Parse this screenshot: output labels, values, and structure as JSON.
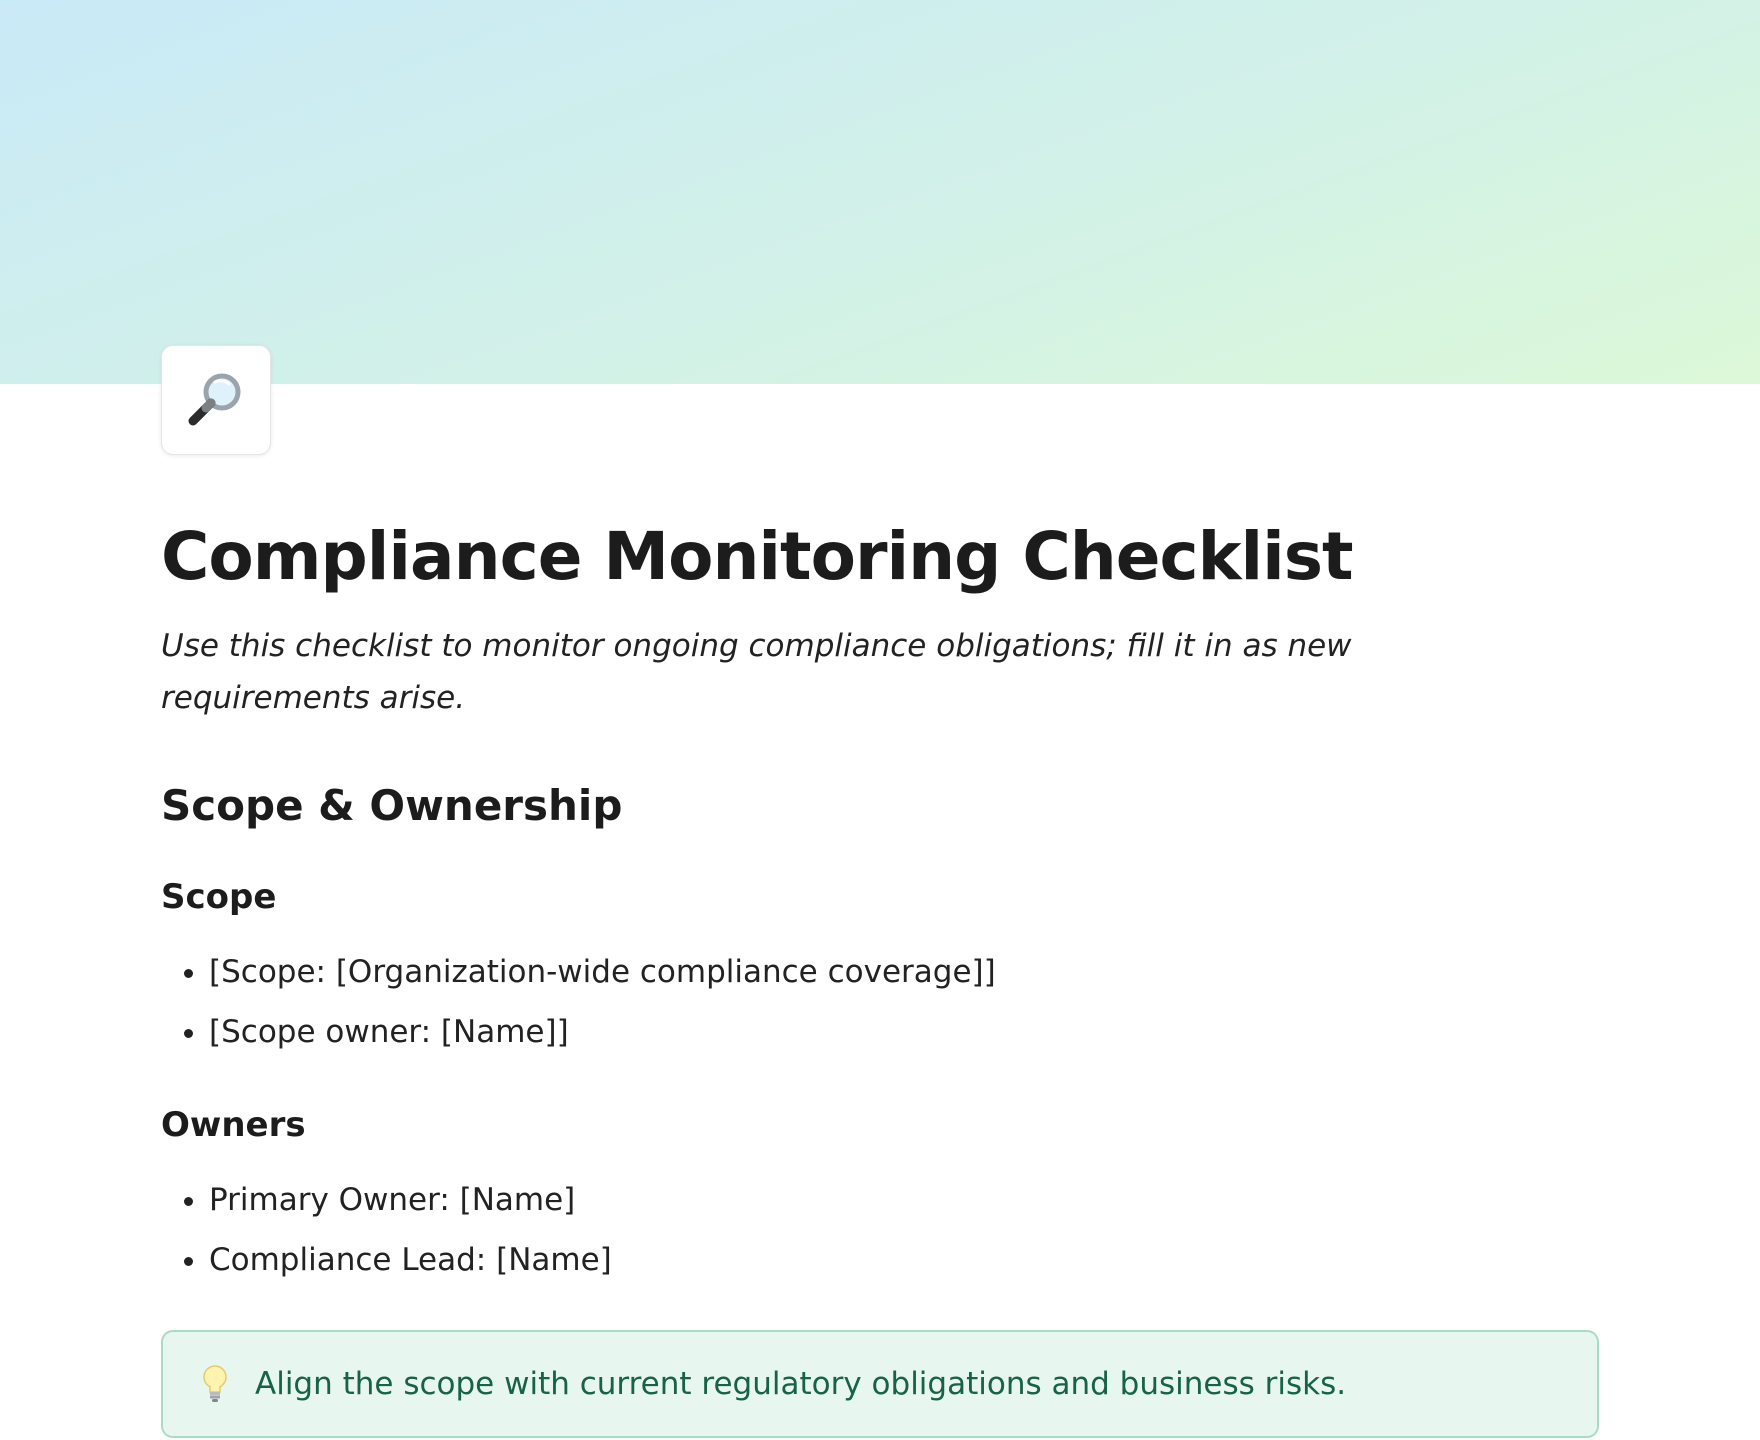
{
  "page": {
    "icon": "magnifying-glass-icon",
    "title": "Compliance Monitoring Checklist",
    "subtitle": "Use this checklist to monitor ongoing compliance obligations; fill it in as new requirements arise."
  },
  "sections": [
    {
      "heading": "Scope & Ownership",
      "subsections": [
        {
          "heading": "Scope",
          "items": [
            "[Scope: [Organization-wide compliance coverage]]",
            "[Scope owner: [Name]]"
          ]
        },
        {
          "heading": "Owners",
          "items": [
            "Primary Owner: [Name]",
            "Compliance Lead: [Name]"
          ]
        }
      ]
    }
  ],
  "callout": {
    "icon": "lightbulb-icon",
    "text": "Align the scope with current regulatory obligations and business risks."
  },
  "colors": {
    "cover_start": "#c9eaf7",
    "cover_end": "#dcf8d8",
    "callout_bg": "#e7f6ee",
    "callout_border": "#a6ddc4",
    "callout_text": "#17634a"
  }
}
